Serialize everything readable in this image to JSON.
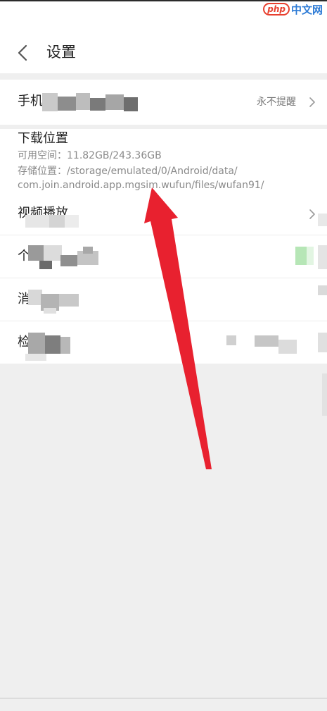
{
  "watermark": {
    "badge": "php",
    "text": "中文网"
  },
  "header": {
    "title": "设置",
    "back_icon": "chevron-left-icon"
  },
  "rows": {
    "mobile_data": {
      "title_visible": "手机",
      "value": "永不提醒"
    },
    "download_location": {
      "title": "下载位置",
      "free_space": "可用空间：11.82GB/243.36GB",
      "storage_line1": "存储位置：/storage/emulated/0/Android/data/",
      "storage_line2": "com.join.android.app.mgsim.wufun/files/wufan91/"
    },
    "video_playback": {
      "title_visible": "视频播放"
    },
    "row_4": {
      "title_visible": "个"
    },
    "row_5": {
      "title_visible": "消"
    },
    "row_6": {
      "title_visible": "检"
    }
  },
  "colors": {
    "arrow": "#e8212f",
    "toggle_on": "#b6e6b6",
    "background": "#efefef"
  }
}
